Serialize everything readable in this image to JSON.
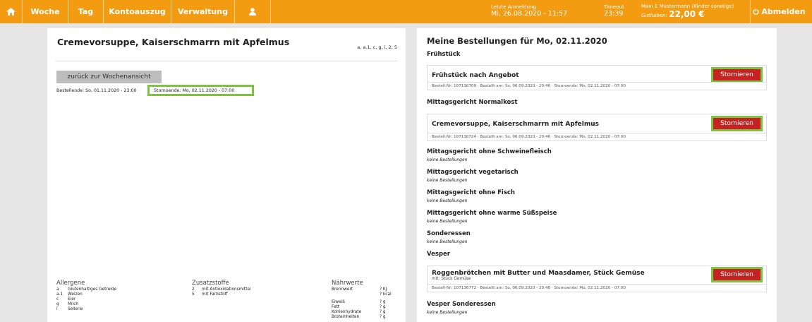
{
  "topbar": {
    "nav": {
      "woche": "Woche",
      "tag": "Tag",
      "kontoauszug": "Kontoauszug",
      "verwaltung": "Verwaltung"
    },
    "last_login_label": "Letzte Anmeldung",
    "last_login_value": "Mi, 26.08.2020 - 11:57",
    "timeout_label": "Timeout",
    "timeout_value": "23:39",
    "user_name": "Maxi 1 Mustermann (Kinder sonstige)",
    "guthaben_label": "Guthaben:",
    "guthaben_value": "22,00 €",
    "logout_label": "Abmelden",
    "accent_color": "#f39c12"
  },
  "left": {
    "dish_title": "Cremevorsuppe, Kaiserschmarrn mit Apfelmus",
    "allergen_codes": "a, a.1, c, g, i, 2, 5",
    "back_button": "zurück zur Wochenansicht",
    "bestellende": "Bestellende: So, 01.11.2020 - 23:00",
    "stornoende": "Stornoende: Mo, 02.11.2020 - 07:00",
    "allergene": {
      "title": "Allergene",
      "items": [
        {
          "code": "a",
          "name": "Glutenhaltiges Getreide"
        },
        {
          "code": "a.1",
          "name": "Weizen"
        },
        {
          "code": "c",
          "name": "Eier"
        },
        {
          "code": "g",
          "name": "Milch"
        },
        {
          "code": "i",
          "name": "Sellerie"
        }
      ]
    },
    "zusatzstoffe": {
      "title": "Zusatzstoffe",
      "items": [
        {
          "code": "2",
          "name": "mit Antioxidationsmittel"
        },
        {
          "code": "5",
          "name": "mit Farbstoff"
        }
      ]
    },
    "naehrwerte": {
      "title": "Nährwerte",
      "items": [
        {
          "name": "Brennwert",
          "value": "? KJ"
        },
        {
          "name": "",
          "value": "? kcal"
        },
        {
          "name": "Eiweiß",
          "value": "? g"
        },
        {
          "name": "Fett",
          "value": "? g"
        },
        {
          "name": "Kohlenhydrate",
          "value": "? g"
        },
        {
          "name": "Broteinheiten",
          "value": "? g"
        }
      ]
    }
  },
  "right": {
    "title": "Meine Bestellungen für Mo, 02.11.2020",
    "storno_label": "Stornieren",
    "keine": "keine Bestellungen",
    "sections": {
      "fruehstueck": "Frühstück",
      "mittag_normal": "Mittagsgericht Normalkost",
      "mittag_ohne_schwein": "Mittagsgericht ohne Schweinefleisch",
      "mittag_veg": "Mittagsgericht vegetarisch",
      "mittag_ohne_fisch": "Mittagsgericht ohne Fisch",
      "mittag_ohne_suess": "Mittagsgericht ohne warme Süßspeise",
      "sonderessen": "Sonderessen",
      "vesper": "Vesper",
      "vesper_sonder": "Vesper Sonderessen"
    },
    "orders": {
      "fruehstueck": {
        "name": "Frühstück nach Angebot",
        "meta": "Bestell-Nr: 107136709   ·   Bestellt am: So, 06.09.2020 - 20:46   ·   Stornoende: Mo, 02.11.2020 - 07:00"
      },
      "mittag": {
        "name": "Cremevorsuppe, Kaiserschmarrn mit Apfelmus",
        "meta": "Bestell-Nr: 107136724   ·   Bestellt am: So, 06.09.2020 - 20:46   ·   Stornoende: Mo, 02.11.2020 - 07:00"
      },
      "vesper": {
        "name": "Roggenbrötchen mit Butter und Maasdamer, Stück Gemüse",
        "sub": "mit: Stück Gemüse",
        "meta": "Bestell-Nr: 107136772   ·   Bestellt am: So, 06.09.2020 - 20:48   ·   Stornoende: Mo, 02.11.2020 - 07:00"
      }
    }
  }
}
